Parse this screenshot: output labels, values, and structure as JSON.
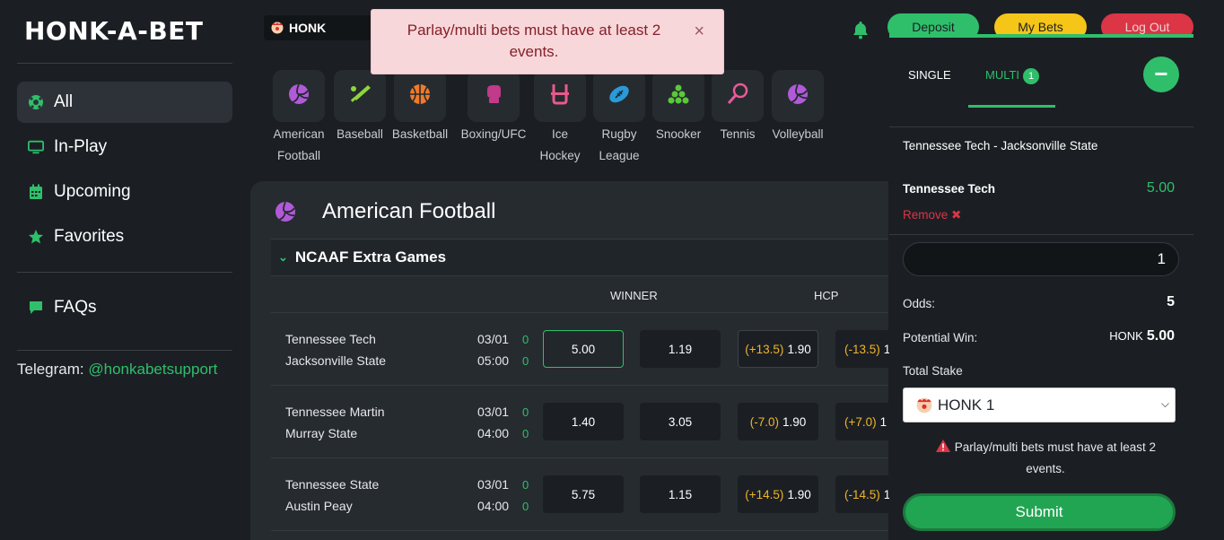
{
  "app": {
    "logo": "HONK-A-BET"
  },
  "sidebar": {
    "items": [
      {
        "label": "All",
        "icon": "soccer-ball-icon"
      },
      {
        "label": "In-Play",
        "icon": "monitor-icon"
      },
      {
        "label": "Upcoming",
        "icon": "calendar-icon"
      },
      {
        "label": "Favorites",
        "icon": "star-icon"
      }
    ],
    "faq": {
      "label": "FAQs",
      "icon": "chat-bubble-icon"
    },
    "telegram_label": "Telegram: ",
    "telegram_link": "@honkabetsupport"
  },
  "header": {
    "currency": "HONK",
    "deposit": "Deposit",
    "my_bets": "My Bets",
    "logout": "Log Out"
  },
  "toast": {
    "message": "Parlay/multi bets must have at least 2 events.",
    "close": "×"
  },
  "sports": [
    {
      "line1": "American",
      "line2": "Football",
      "icon": "volleyball-icon",
      "color": "#b05ad8"
    },
    {
      "line1": "Baseball",
      "line2": "",
      "icon": "baseball-bat-icon",
      "color": "#8dd63a"
    },
    {
      "line1": "Basketball",
      "line2": "",
      "icon": "basketball-icon",
      "color": "#f07a2a"
    },
    {
      "line1": "Boxing/UFC",
      "line2": "",
      "icon": "boxing-glove-icon",
      "color": "#c23a8a"
    },
    {
      "line1": "Ice",
      "line2": "Hockey",
      "icon": "hockey-sticks-icon",
      "color": "#e85a8a"
    },
    {
      "line1": "Rugby",
      "line2": "League",
      "icon": "rugby-ball-icon",
      "color": "#2a9ad8"
    },
    {
      "line1": "Snooker",
      "line2": "",
      "icon": "snooker-balls-icon",
      "color": "#5ac83a"
    },
    {
      "line1": "Tennis",
      "line2": "",
      "icon": "tennis-racket-icon",
      "color": "#e85a9a"
    },
    {
      "line1": "Volleyball",
      "line2": "",
      "icon": "volleyball-icon",
      "color": "#b05ad8"
    }
  ],
  "panel": {
    "title": "American Football",
    "league": "NCAAF Extra Games",
    "col_winner": "WINNER",
    "col_hcp": "HCP",
    "games": [
      {
        "home": "Tennessee Tech",
        "away": "Jacksonville State",
        "date": "03/01",
        "time": "05:00",
        "s1": "0",
        "s2": "0",
        "w1": "5.00",
        "w2": "1.19",
        "h1_line": "(+13.5)",
        "h1_odd": "1.90",
        "h2_line": "(-13.5)",
        "h2_odd": "1"
      },
      {
        "home": "Tennessee Martin",
        "away": "Murray State",
        "date": "03/01",
        "time": "04:00",
        "s1": "0",
        "s2": "0",
        "w1": "1.40",
        "w2": "3.05",
        "h1_line": "(-7.0)",
        "h1_odd": "1.90",
        "h2_line": "(+7.0)",
        "h2_odd": "1"
      },
      {
        "home": "Tennessee State",
        "away": "Austin Peay",
        "date": "03/01",
        "time": "04:00",
        "s1": "0",
        "s2": "0",
        "w1": "5.75",
        "w2": "1.15",
        "h1_line": "(+14.5)",
        "h1_odd": "1.90",
        "h2_line": "(-14.5)",
        "h2_odd": "1"
      }
    ]
  },
  "betslip": {
    "tab_single": "SINGLE",
    "tab_multi": "MULTI",
    "multi_count": "1",
    "minus": "−",
    "match": "Tennessee Tech - Jacksonville State",
    "selection": "Tennessee Tech",
    "selection_odd": "5.00",
    "remove": "Remove",
    "amount": "1",
    "odds_label": "Odds:",
    "odds_value": "5",
    "potential_label": "Potential Win:",
    "potential_currency": "HONK",
    "potential_value": "5.00",
    "total_stake_label": "Total Stake",
    "stake_option": "HONK 1",
    "warning": "Parlay/multi bets must have at least 2 events.",
    "submit": "Submit"
  },
  "colors": {
    "accent": "#2fbf6b",
    "deposit": "#2fbf6b",
    "mybets": "#f5c518",
    "logout": "#dc3545",
    "hcp": "#f0b429"
  }
}
